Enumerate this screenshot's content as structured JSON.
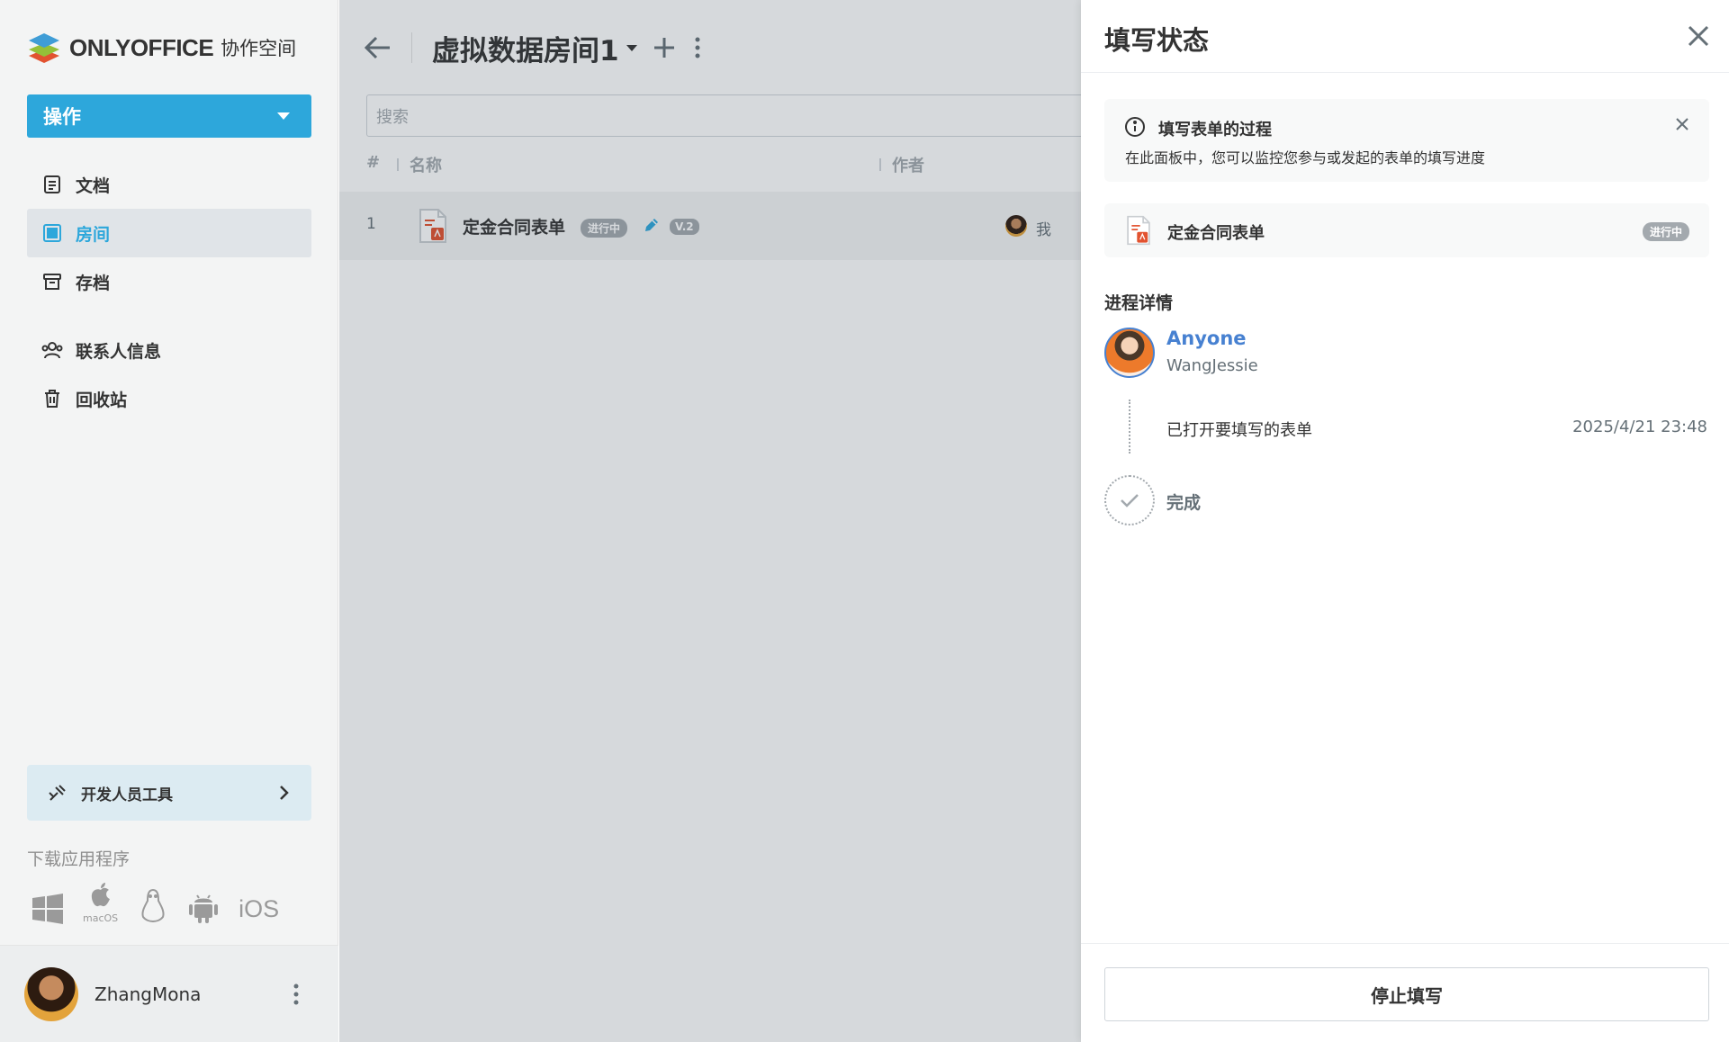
{
  "brand": {
    "name": "ONLYOFFICE",
    "sub": "协作空间"
  },
  "sidebar": {
    "action_label": "操作",
    "items": [
      {
        "label": "文档",
        "icon": "document-icon"
      },
      {
        "label": "房间",
        "icon": "rooms-icon",
        "active": true
      },
      {
        "label": "存档",
        "icon": "archive-icon"
      },
      {
        "label": "联系人信息",
        "icon": "contacts-icon"
      },
      {
        "label": "回收站",
        "icon": "trash-icon"
      }
    ],
    "devtools_label": "开发人员工具",
    "download_label": "下载应用程序",
    "apps": {
      "macos": "macOS",
      "ios": "iOS"
    },
    "user_name": "ZhangMona"
  },
  "main": {
    "room_title": "虚拟数据房间1",
    "search_placeholder": "搜索",
    "columns": {
      "num": "#",
      "name": "名称",
      "author": "作者"
    },
    "rows": [
      {
        "num": "1",
        "name": "定金合同表单",
        "status": "进行中",
        "version": "V.2",
        "author": "我"
      }
    ]
  },
  "panel": {
    "title": "填写状态",
    "info": {
      "title": "填写表单的过程",
      "text": "在此面板中，您可以监控您参与或发起的表单的填写进度"
    },
    "file": {
      "name": "定金合同表单",
      "status": "进行中"
    },
    "section_title": "进程详情",
    "step": {
      "role": "Anyone",
      "user": "WangJessie",
      "action": "已打开要填写的表单",
      "time": "2025/4/21 23:48"
    },
    "done_label": "完成",
    "stop_label": "停止填写"
  },
  "colors": {
    "accent": "#2da7db",
    "link": "#4781d1",
    "badge": "#a3a9ae"
  }
}
